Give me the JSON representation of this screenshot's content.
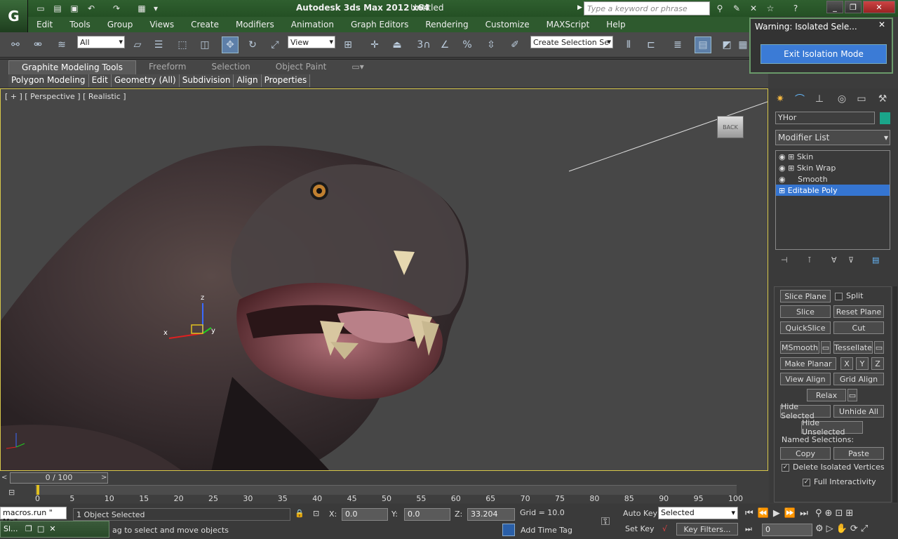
{
  "titlebar": {
    "title": "Autodesk 3ds Max  2012 x64",
    "document": "Untitled",
    "search_placeholder": "Type a keyword or phrase"
  },
  "menu": [
    "Edit",
    "Tools",
    "Group",
    "Views",
    "Create",
    "Modifiers",
    "Animation",
    "Graph Editors",
    "Rendering",
    "Customize",
    "MAXScript",
    "Help"
  ],
  "toolbar": {
    "filter_value": "All",
    "refcoord_value": "View",
    "selection_set_value": "Create Selection Se",
    "snap_number": "3"
  },
  "ribbon": {
    "tabs": [
      "Graphite Modeling Tools",
      "Freeform",
      "Selection",
      "Object Paint"
    ],
    "subtabs": [
      "Polygon Modeling",
      "Edit",
      "Geometry (All)",
      "Subdivision",
      "Align",
      "Properties"
    ]
  },
  "viewport": {
    "label": "[ + ] [ Perspective ] [ Realistic ]",
    "gizmo_axes": [
      "x",
      "y",
      "z"
    ],
    "viewcube_face": "BACK"
  },
  "warning": {
    "title": "Warning: Isolated Sele...",
    "button": "Exit Isolation Mode"
  },
  "command_panel": {
    "object_name": "YHor",
    "object_color": "#1aa58a",
    "modifier_list": "Modifier List",
    "stack": [
      "Skin",
      "Skin Wrap",
      "Smooth",
      "Editable Poly"
    ],
    "buttons": {
      "slice_plane": "Slice Plane",
      "split": "Split",
      "slice": "Slice",
      "reset_plane": "Reset Plane",
      "quickslice": "QuickSlice",
      "cut": "Cut",
      "msmooth": "MSmooth",
      "tessellate": "Tessellate",
      "make_planar": "Make Planar",
      "x": "X",
      "y": "Y",
      "z": "Z",
      "view_align": "View Align",
      "grid_align": "Grid Align",
      "relax": "Relax",
      "hide_selected": "Hide Selected",
      "unhide_all": "Unhide All",
      "hide_unselected": "Hide Unselected",
      "named_selections": "Named Selections:",
      "copy": "Copy",
      "paste": "Paste",
      "delete_isolated": "Delete Isolated Vertices",
      "full_interactivity": "Full Interactivity"
    }
  },
  "timeline": {
    "frame_display": "0 / 100",
    "ticks": [
      "0",
      "5",
      "10",
      "15",
      "20",
      "25",
      "30",
      "35",
      "40",
      "45",
      "50",
      "55",
      "60",
      "65",
      "70",
      "75",
      "80",
      "85",
      "90",
      "95",
      "100"
    ]
  },
  "status": {
    "macro": "macros.run \" Mo\"",
    "task": "Sl...",
    "selection": "1 Object Selected",
    "message": "ag to select and move objects",
    "x_label": "X:",
    "x_value": "0.0",
    "y_label": "Y:",
    "y_value": "0.0",
    "z_label": "Z:",
    "z_value": "33.204",
    "grid": "Grid = 10.0",
    "add_time_tag": "Add Time Tag",
    "auto_key": "Auto Key",
    "selected": "Selected",
    "set_key": "Set Key",
    "key_filters": "Key Filters...",
    "current_frame": "0"
  }
}
